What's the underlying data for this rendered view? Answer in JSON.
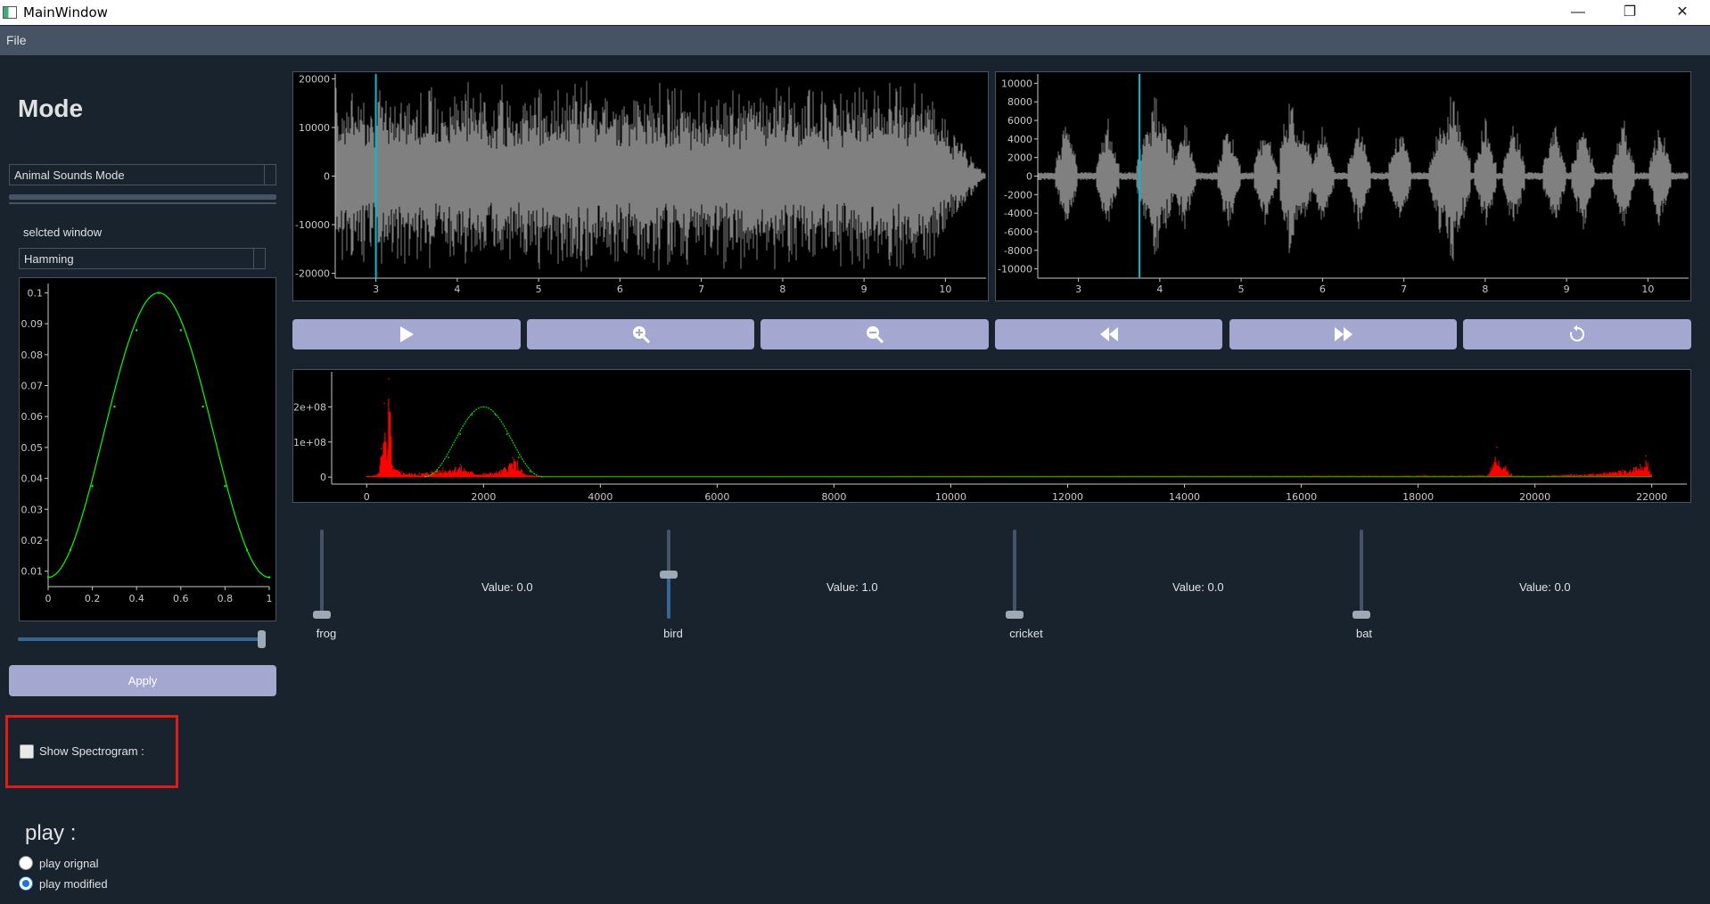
{
  "window": {
    "title": "MainWindow",
    "minimize": "—",
    "maximize": "❐",
    "close": "✕"
  },
  "menu": {
    "file": "File"
  },
  "sidebar": {
    "mode_title": "Mode",
    "mode_select": "Animal Sounds Mode",
    "selected_window_label": "selcted window",
    "window_select": "Hamming",
    "window_param_level": 1.0,
    "apply_label": "Apply",
    "show_spectrogram_label": "Show Spectrogram :",
    "show_spectrogram_checked": false,
    "play_title": "play :",
    "play_original_label": "play orignal",
    "play_modified_label": "play modified",
    "play_selected": "modified"
  },
  "chart_data": [
    {
      "type": "line",
      "name": "window-plot",
      "x": [
        0,
        0.1,
        0.2,
        0.3,
        0.4,
        0.5,
        0.6,
        0.7,
        0.8,
        0.9,
        1.0
      ],
      "values": [
        0.008,
        0.0168,
        0.0375,
        0.0632,
        0.0879,
        0.1,
        0.0879,
        0.0632,
        0.0375,
        0.0168,
        0.008
      ],
      "xlim": [
        0,
        1
      ],
      "ylim": [
        0.005,
        0.103
      ],
      "xticks": [
        "0",
        "0.2",
        "0.4",
        "0.6",
        "0.8",
        "1"
      ],
      "yticks": [
        "0.01",
        "0.02",
        "0.03",
        "0.04",
        "0.05",
        "0.06",
        "0.07",
        "0.08",
        "0.09",
        "0.1"
      ],
      "color": "#00ff00"
    },
    {
      "type": "line",
      "name": "input-signal",
      "xlim": [
        2.5,
        10.5
      ],
      "ylim": [
        -21000,
        21000
      ],
      "xticks": [
        "3",
        "4",
        "5",
        "6",
        "7",
        "8",
        "9",
        "10"
      ],
      "yticks": [
        "20000",
        "10000",
        "0",
        "-10000",
        "-20000"
      ],
      "cursor_x": 3.0,
      "color": "#808080",
      "cursor_color": "#00bcd4"
    },
    {
      "type": "line",
      "name": "output-signal",
      "xlim": [
        2.5,
        10.5
      ],
      "ylim": [
        -11000,
        11000
      ],
      "xticks": [
        "3",
        "4",
        "5",
        "6",
        "7",
        "8",
        "9",
        "10"
      ],
      "yticks": [
        "10000",
        "8000",
        "6000",
        "4000",
        "2000",
        "0",
        "-2000",
        "-4000",
        "-6000",
        "-8000",
        "-10000"
      ],
      "cursor_x": 3.75,
      "color": "#808080",
      "cursor_color": "#00bcd4"
    },
    {
      "type": "line",
      "name": "frequency-spectrum",
      "xlim": [
        -600,
        22600
      ],
      "ylim": [
        -20000000,
        300000000
      ],
      "xticks": [
        "0",
        "2000",
        "4000",
        "6000",
        "8000",
        "10000",
        "12000",
        "14000",
        "16000",
        "18000",
        "20000",
        "22000"
      ],
      "yticks": [
        "2e+08",
        "1e+08",
        "0"
      ],
      "series": [
        {
          "color": "#ff0000",
          "x": [
            0,
            200,
            250,
            300,
            350,
            380,
            450,
            600,
            900,
            1300,
            1600,
            1800,
            2000,
            2300,
            2500,
            2580,
            2700,
            3000,
            19200,
            19350,
            19500,
            19600,
            19800,
            21000,
            21500,
            21800,
            21900,
            22000
          ],
          "values": [
            2000000,
            10000000,
            80000000,
            210000000,
            40000000,
            280000000,
            30000000,
            15000000,
            10000000,
            25000000,
            35000000,
            15000000,
            10000000,
            20000000,
            55000000,
            45000000,
            8000000,
            2000000,
            5000000,
            85000000,
            30000000,
            8000000,
            3000000,
            10000000,
            20000000,
            35000000,
            60000000,
            3000000
          ]
        },
        {
          "color": "#00ff00",
          "x": [
            1000,
            1200,
            1400,
            1600,
            1800,
            2000,
            2200,
            2400,
            2600,
            2800,
            3000
          ],
          "values": [
            1000000,
            16000000,
            56000000,
            122000000,
            178000000,
            200000000,
            178000000,
            122000000,
            56000000,
            16000000,
            1000000
          ]
        }
      ]
    }
  ],
  "transport": {
    "play": "play-icon",
    "zoom_in": "zoom-in-icon",
    "zoom_out": "zoom-out-icon",
    "rewind": "rewind-icon",
    "fast_forward": "fast-forward-icon",
    "reset": "reset-icon"
  },
  "sliders": [
    {
      "label": "frog",
      "value_text": "Value: 0.0",
      "level": 0.0
    },
    {
      "label": "bird",
      "value_text": "Value: 1.0",
      "level": 0.5
    },
    {
      "label": "cricket",
      "value_text": "Value: 0.0",
      "level": 0.0
    },
    {
      "label": "bat",
      "value_text": "Value: 0.0",
      "level": 0.0
    }
  ]
}
